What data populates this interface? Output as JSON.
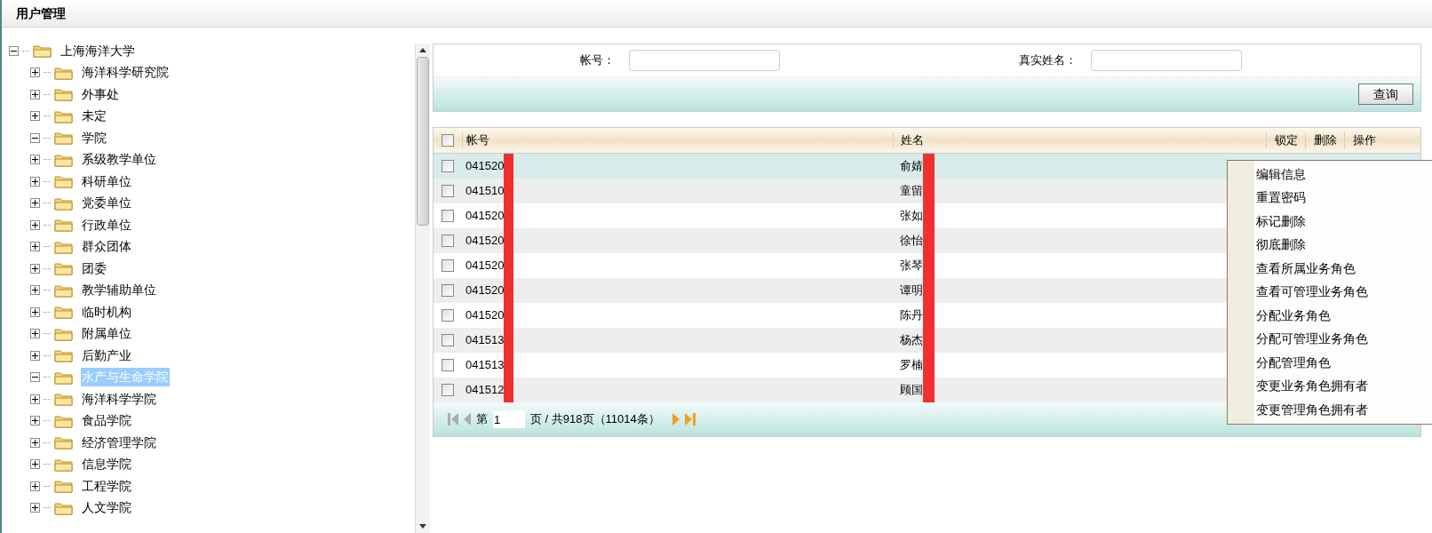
{
  "header": {
    "title": "用户管理"
  },
  "tree": {
    "label": "上海海洋大学",
    "expanded": true,
    "selected": false,
    "children": [
      {
        "label": "海洋科学研究院",
        "expanded": false,
        "selected": false
      },
      {
        "label": "外事处",
        "expanded": false,
        "selected": false
      },
      {
        "label": "未定",
        "expanded": false,
        "selected": false
      },
      {
        "label": "学院",
        "expanded": true,
        "selected": false
      },
      {
        "label": "系级教学单位",
        "expanded": false,
        "selected": false
      },
      {
        "label": "科研单位",
        "expanded": false,
        "selected": false
      },
      {
        "label": "党委单位",
        "expanded": false,
        "selected": false
      },
      {
        "label": "行政单位",
        "expanded": false,
        "selected": false
      },
      {
        "label": "群众团体",
        "expanded": false,
        "selected": false
      },
      {
        "label": "团委",
        "expanded": false,
        "selected": false
      },
      {
        "label": "教学辅助单位",
        "expanded": false,
        "selected": false
      },
      {
        "label": "临时机构",
        "expanded": false,
        "selected": false
      },
      {
        "label": "附属单位",
        "expanded": false,
        "selected": false
      },
      {
        "label": "后勤产业",
        "expanded": false,
        "selected": false
      },
      {
        "label": "水产与生命学院",
        "expanded": true,
        "selected": true
      },
      {
        "label": "海洋科学学院",
        "expanded": false,
        "selected": false
      },
      {
        "label": "食品学院",
        "expanded": false,
        "selected": false
      },
      {
        "label": "经济管理学院",
        "expanded": false,
        "selected": false
      },
      {
        "label": "信息学院",
        "expanded": false,
        "selected": false
      },
      {
        "label": "工程学院",
        "expanded": false,
        "selected": false
      },
      {
        "label": "人文学院",
        "expanded": false,
        "selected": false
      }
    ]
  },
  "search": {
    "fields": [
      {
        "label": "帐号："
      },
      {
        "label": "真实姓名："
      }
    ],
    "button": "查询"
  },
  "table": {
    "columns": [
      "帐号",
      "姓名",
      "锁定",
      "删除",
      "操作"
    ],
    "header_checked": false,
    "rows": [
      {
        "account": "041520",
        "name": "俞婧",
        "checked": false,
        "selected": true
      },
      {
        "account": "041510",
        "name": "童留",
        "checked": false,
        "selected": false
      },
      {
        "account": "041520",
        "name": "张如",
        "checked": false,
        "selected": false
      },
      {
        "account": "041520",
        "name": "徐怡",
        "checked": false,
        "selected": false
      },
      {
        "account": "041520",
        "name": "张琴",
        "checked": false,
        "selected": false
      },
      {
        "account": "041520",
        "name": "谭明",
        "checked": false,
        "selected": false
      },
      {
        "account": "041520",
        "name": "陈丹",
        "checked": false,
        "selected": false
      },
      {
        "account": "041513",
        "name": "杨杰",
        "checked": false,
        "selected": false
      },
      {
        "account": "041513",
        "name": "罗楠",
        "checked": false,
        "selected": false
      },
      {
        "account": "041512",
        "name": "顾国",
        "checked": false,
        "selected": false
      }
    ]
  },
  "pager": {
    "prefix": "第",
    "page": "1",
    "suffix": "页 / 共918页（11014条）"
  },
  "context_menu": [
    "编辑信息",
    "重置密码",
    "标记删除",
    "彻底删除",
    "查看所属业务角色",
    "查看可管理业务角色",
    "分配业务角色",
    "分配可管理业务角色",
    "分配管理角色",
    "变更业务角色拥有者",
    "变更管理角色拥有者"
  ]
}
